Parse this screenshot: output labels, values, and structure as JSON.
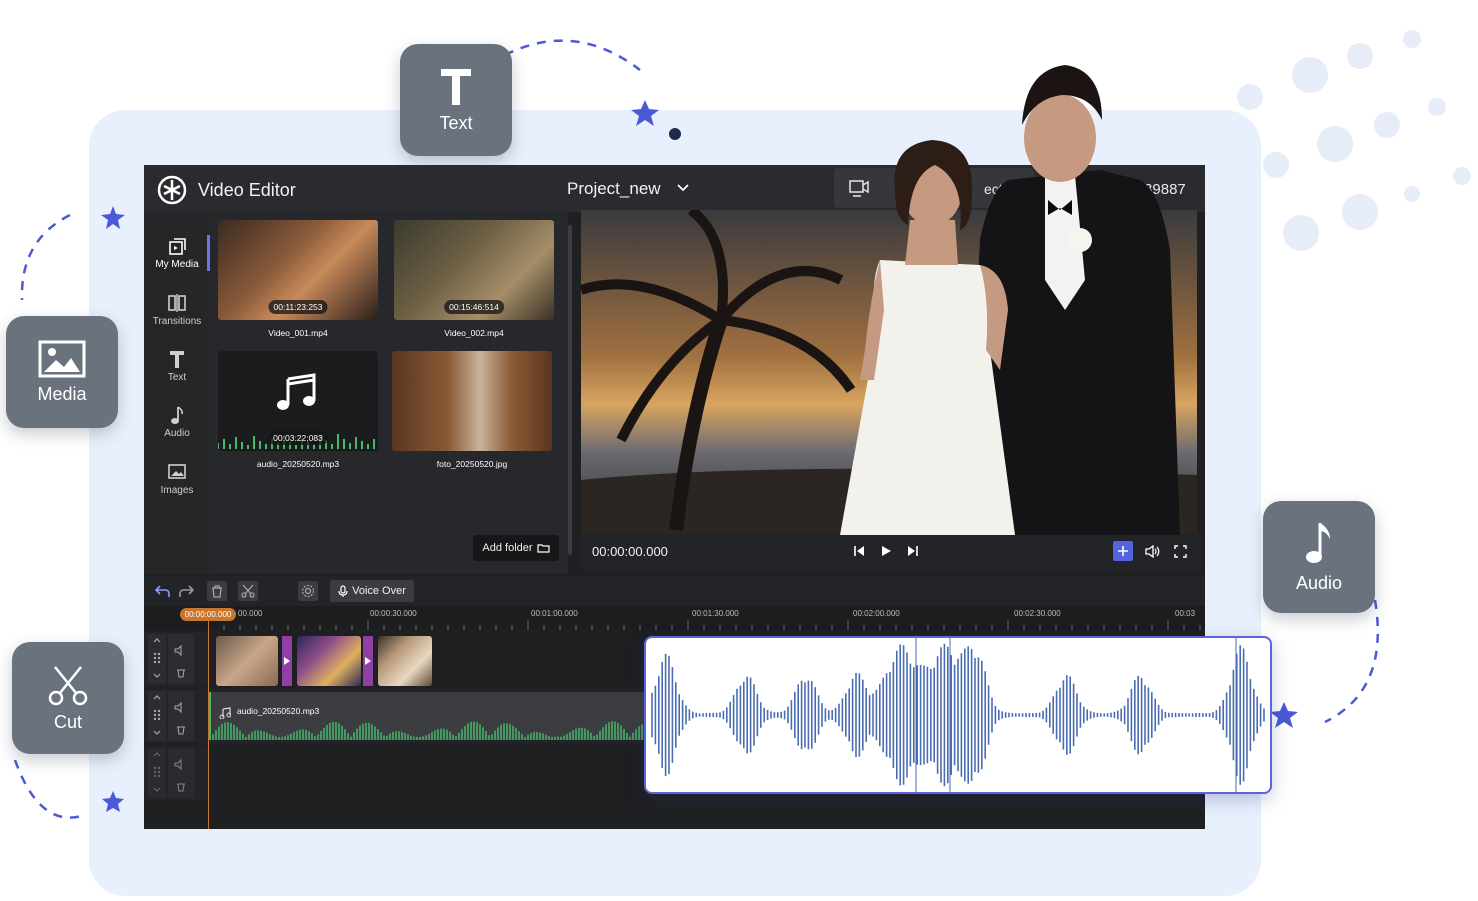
{
  "app": {
    "title": "Video Editor",
    "project": "Project_new",
    "top_action": "ects",
    "user_id": "66658239887"
  },
  "tiles": {
    "text": "Text",
    "media": "Media",
    "cut": "Cut",
    "audio": "Audio"
  },
  "sidebar": {
    "items": [
      {
        "label": "My Media",
        "icon": "media-stack-icon"
      },
      {
        "label": "Transitions",
        "icon": "transitions-icon"
      },
      {
        "label": "Text",
        "icon": "text-icon"
      },
      {
        "label": "Audio",
        "icon": "music-note-icon"
      },
      {
        "label": "Images",
        "icon": "image-icon"
      }
    ]
  },
  "media": {
    "items": [
      {
        "name": "Video_001.mp4",
        "duration": "00:11:23:253"
      },
      {
        "name": "Video_002.mp4",
        "duration": "00:15:46:514"
      },
      {
        "name": "audio_20250520.mp3",
        "duration": "00:03:22:083"
      },
      {
        "name": "foto_20250520.jpg",
        "duration": ""
      }
    ],
    "add_folder": "Add folder"
  },
  "preview": {
    "timecode": "00:00:00.000"
  },
  "toolbar": {
    "voice_over": "Voice Over"
  },
  "ruler": {
    "playhead": "00:00:00.000",
    "labels": [
      "00.000",
      "00:00:30.000",
      "00:01:00.000",
      "00:01:30.000",
      "00:02:00.000",
      "00:02:30.000",
      "00:03"
    ]
  },
  "tracks": {
    "audio_clip_name": "audio_20250520.mp3"
  },
  "colors": {
    "accent": "#5563e0",
    "playhead": "#c9752c",
    "transition": "#8f3fa6",
    "audio_wave": "#46b96a",
    "waveform_callout": "#4a6cb0"
  }
}
